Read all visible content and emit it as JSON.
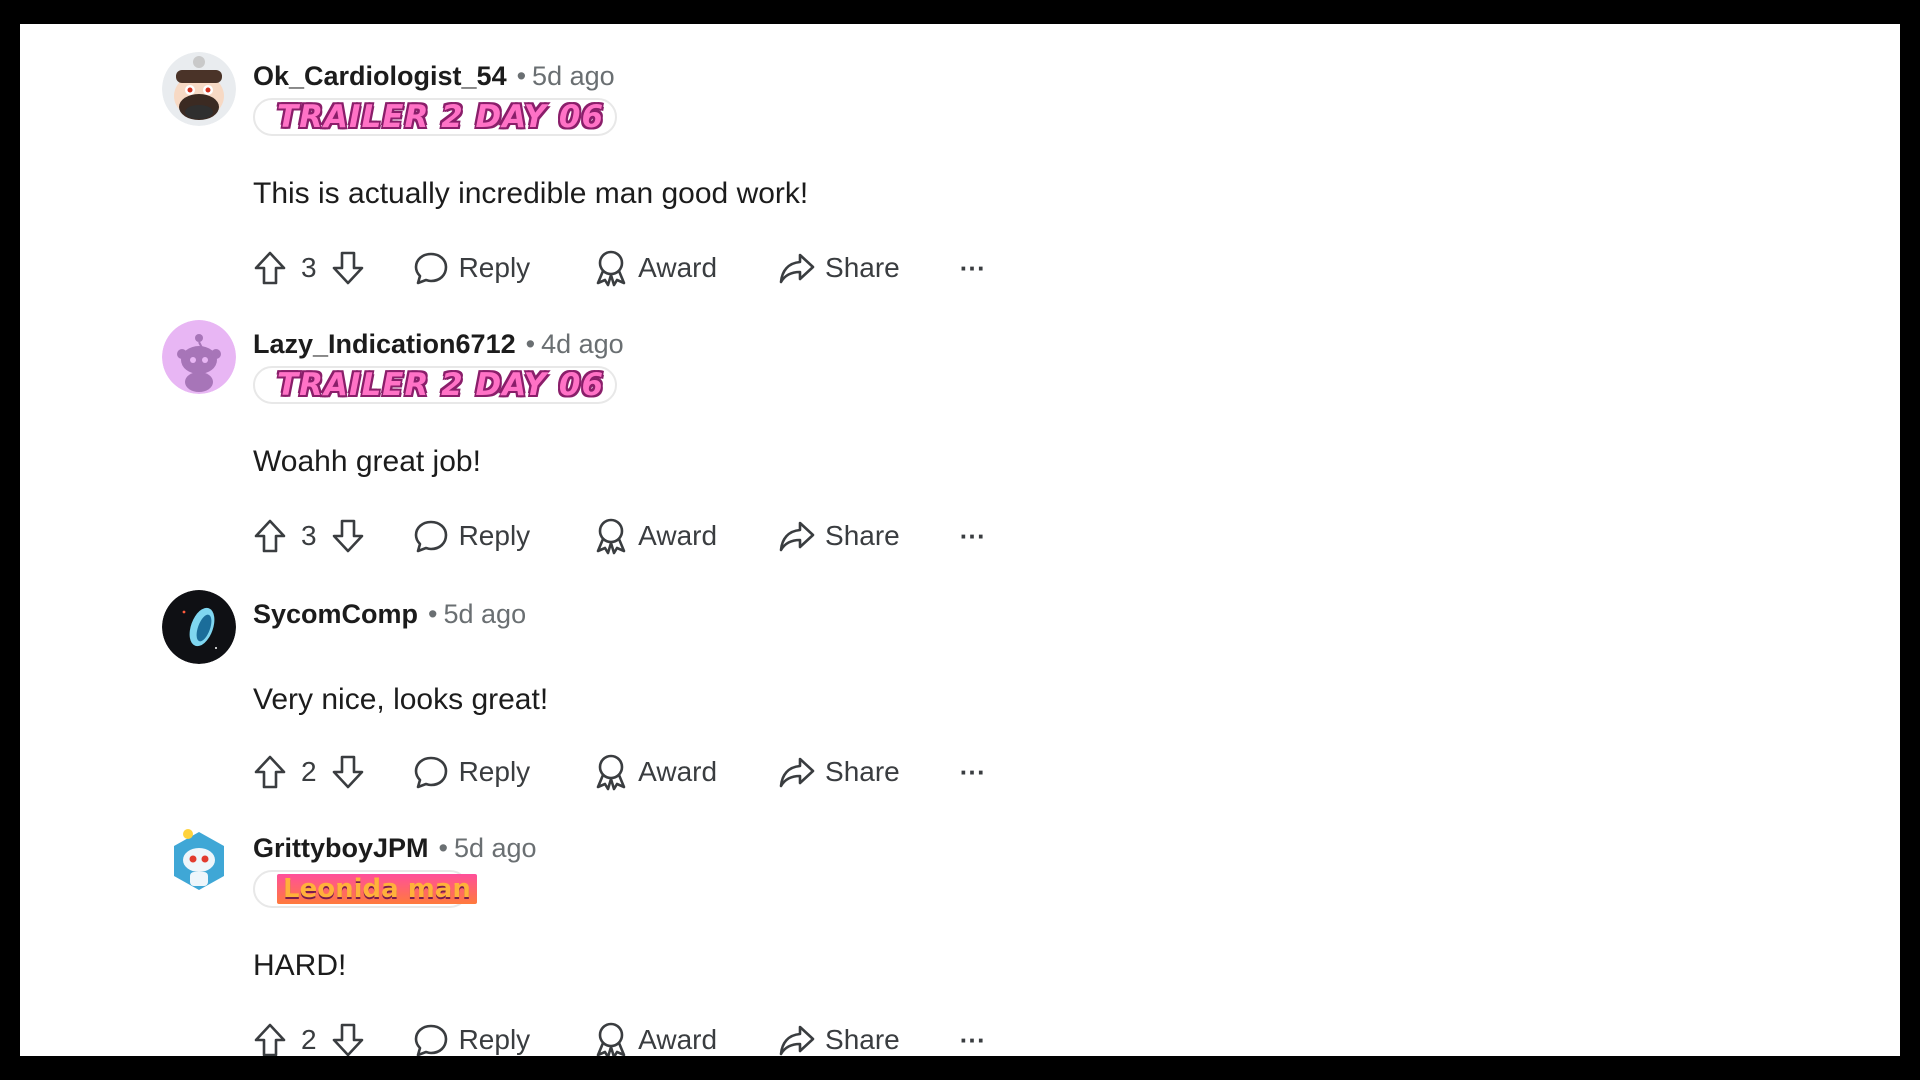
{
  "comments": [
    {
      "username": "Ok_Cardiologist_54",
      "separator": "•",
      "time": "5d ago",
      "flair": "TRAILER 2 DAY 06",
      "text": "This is actually incredible man good work!",
      "votes": "3",
      "avatar_icon": "snoo-bearded-avatar-icon"
    },
    {
      "username": "Lazy_Indication6712",
      "separator": "•",
      "time": "4d ago",
      "flair": "TRAILER 2 DAY 06",
      "text": "Woahh great job!",
      "votes": "3",
      "avatar_icon": "snoo-default-purple-avatar-icon"
    },
    {
      "username": "SycomComp",
      "separator": "•",
      "time": "5d ago",
      "flair": "",
      "text": "Very nice, looks great!",
      "votes": "2",
      "avatar_icon": "planet-avatar-icon"
    },
    {
      "username": "GrittyboyJPM",
      "separator": "•",
      "time": "5d ago",
      "flair": "Leonida man",
      "text": "HARD!",
      "votes": "2",
      "avatar_icon": "snoo-astronaut-avatar-icon"
    }
  ],
  "actions": {
    "reply": "Reply",
    "award": "Award",
    "share": "Share",
    "more": "···"
  },
  "colors": {
    "frame": "#000000",
    "panel": "#ffffff",
    "text": "#1c1c1c",
    "muted": "#6a6f72",
    "flair_pink": "#ff72c6"
  }
}
